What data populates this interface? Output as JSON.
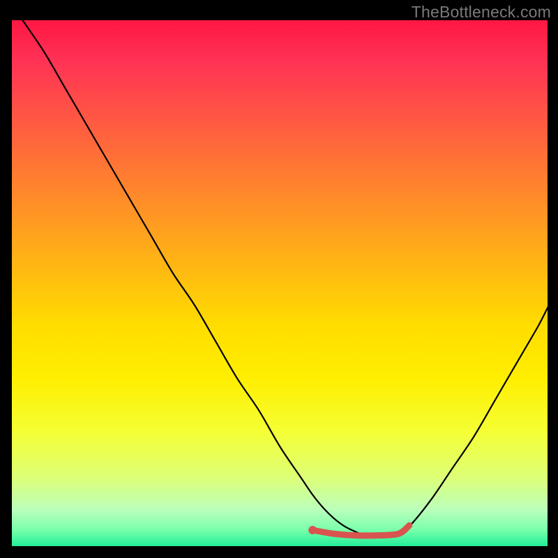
{
  "watermark": "TheBottleneck.com",
  "chart_data": {
    "type": "line",
    "title": "",
    "xlabel": "",
    "ylabel": "",
    "xlim": [
      0,
      100
    ],
    "ylim": [
      0,
      100
    ],
    "series": [
      {
        "name": "bottleneck-curve",
        "color": "#000000",
        "x": [
          2,
          6,
          10,
          14,
          18,
          22,
          26,
          30,
          34,
          38,
          42,
          46,
          50,
          54,
          56,
          58,
          60,
          62,
          64,
          66,
          68,
          70,
          72,
          74,
          78,
          82,
          86,
          90,
          94,
          98,
          100
        ],
        "y": [
          100,
          94,
          87,
          80,
          73,
          66,
          59,
          52,
          46,
          39,
          32,
          26,
          19,
          13,
          10,
          7.5,
          5.5,
          4,
          3,
          2.2,
          2,
          2,
          2.5,
          4,
          9,
          15,
          21,
          28,
          35,
          42,
          46
        ]
      },
      {
        "name": "highlight-segment",
        "color": "#d9534f",
        "x": [
          56,
          60,
          64,
          68,
          72,
          74
        ],
        "y": [
          3.3,
          2.6,
          2.3,
          2.3,
          2.6,
          4.2
        ]
      }
    ],
    "background_gradient": {
      "top": "#ff1744",
      "mid": "#ffdd00",
      "bottom": "#22ee99"
    }
  }
}
